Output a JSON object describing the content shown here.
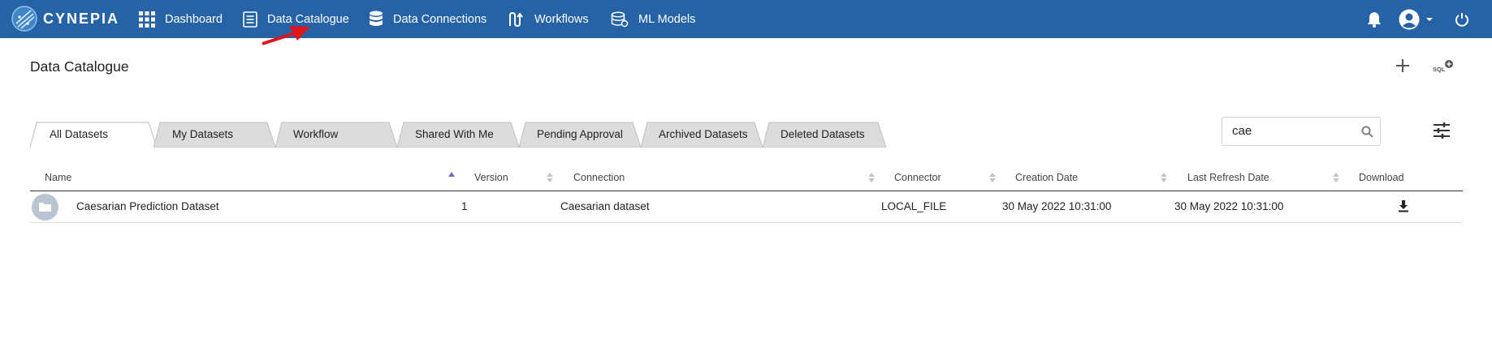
{
  "topbar": {
    "brand": "CYNEPIA",
    "nav": [
      {
        "label": "Dashboard",
        "icon": "grid-icon"
      },
      {
        "label": "Data Catalogue",
        "icon": "catalogue-icon"
      },
      {
        "label": "Data Connections",
        "icon": "database-icon"
      },
      {
        "label": "Workflows",
        "icon": "workflow-icon"
      },
      {
        "label": "ML Models",
        "icon": "ml-models-icon"
      }
    ],
    "right_icons": [
      "bell-icon",
      "user-avatar-icon",
      "caret-down-icon",
      "power-icon"
    ]
  },
  "page": {
    "title": "Data Catalogue",
    "sql_badge": "SQL"
  },
  "tabs": [
    {
      "label": "All Datasets",
      "active": true
    },
    {
      "label": "My Datasets",
      "active": false
    },
    {
      "label": "Workflow",
      "active": false
    },
    {
      "label": "Shared With Me",
      "active": false
    },
    {
      "label": "Pending Approval",
      "active": false
    },
    {
      "label": "Archived Datasets",
      "active": false
    },
    {
      "label": "Deleted Datasets",
      "active": false
    }
  ],
  "search": {
    "value": "cae",
    "placeholder": ""
  },
  "table": {
    "columns": [
      "Name",
      "Version",
      "Connection",
      "Connector",
      "Creation Date",
      "Last Refresh Date",
      "Download"
    ],
    "rows": [
      {
        "name": "Caesarian Prediction Dataset",
        "version": "1",
        "connection": "Caesarian dataset",
        "connector": "LOCAL_FILE",
        "creation_date": "30 May 2022 10:31:00",
        "last_refresh_date": "30 May 2022 10:31:00"
      }
    ]
  },
  "colors": {
    "nav_bg": "#2563a6",
    "tab_bg": "#dcdcdc",
    "accent": "#7b63c9",
    "arrow": "#e0141b"
  }
}
